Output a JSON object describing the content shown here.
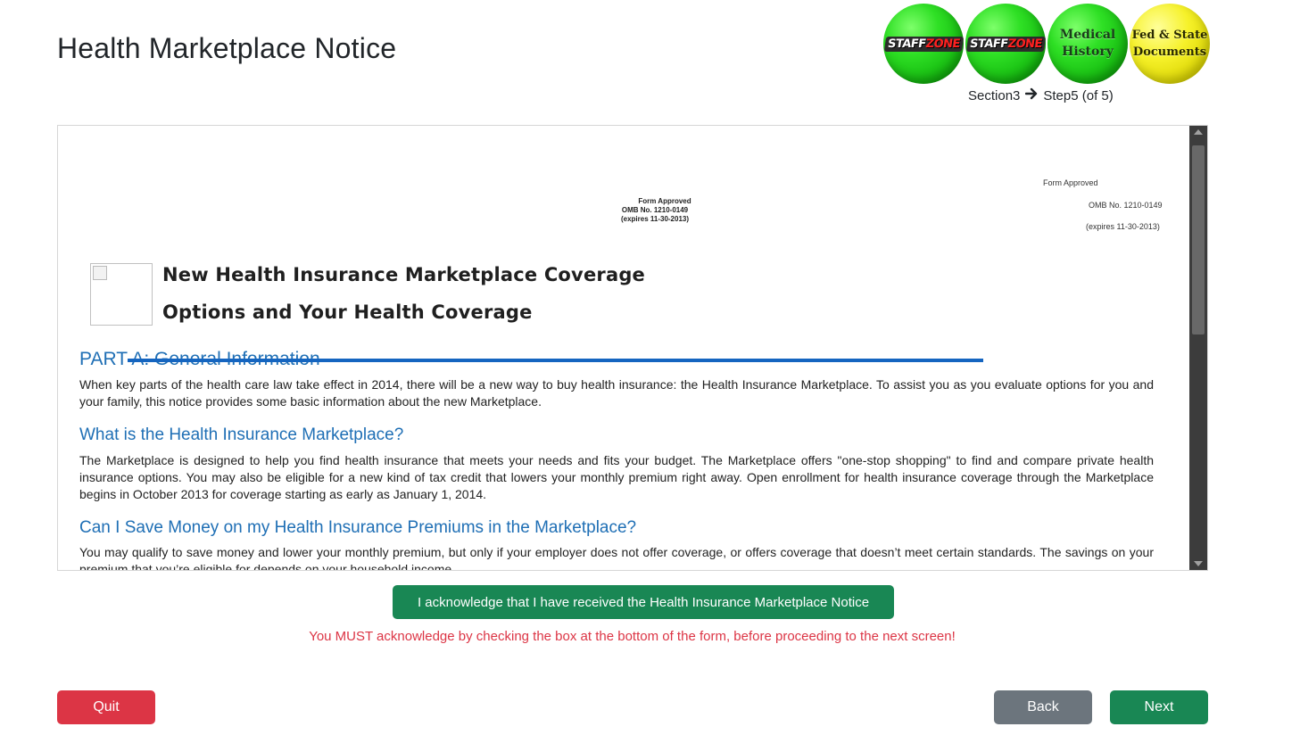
{
  "page": {
    "title": "Health Marketplace Notice"
  },
  "steps": [
    {
      "name": "staffzone-badge-1",
      "logo_main": "STAFF",
      "logo_accent": "ZONE",
      "color": "green"
    },
    {
      "name": "staffzone-badge-2",
      "logo_main": "STAFF",
      "logo_accent": "ZONE",
      "color": "green"
    },
    {
      "name": "medical-history-badge",
      "line1": "Medical",
      "line2": "History",
      "color": "green"
    },
    {
      "name": "fed-state-docs-badge",
      "line1": "Fed & State",
      "line2": "Documents",
      "color": "yellow"
    }
  ],
  "progress": {
    "section": "Section3",
    "step": "Step5 (of 5)",
    "arrow_icon": "arrow-right-icon"
  },
  "document": {
    "form_approved_center": {
      "line1": "Form Approved",
      "line2": "OMB No. 1210-0149",
      "line3": "(expires 11-30-2013)"
    },
    "form_approved_right": {
      "line1": "Form Approved",
      "line2": "OMB No. 1210-0149",
      "line3": "(expires 11-30-2013)"
    },
    "title_line1": "New Health  Insurance Marketplace  Coverage",
    "title_line2": "Options and  Your  Health  Coverage",
    "part_a": "PART A: General  Information",
    "intro": "When key parts of the health care law take effect in 2014, there will be a new way to buy health insurance:  the Health Insurance Marketplace. To assist you as you evaluate options for you and your family, this notice provides some basic information about the new Marketplace.",
    "h1": "What is the Health Insurance Marketplace?",
    "p1": "The Marketplace is designed to help you find health insurance that meets your needs and fits your budget. The Marketplace offers \"one-stop shopping\" to find and compare private health insurance options. You may also be eligible for a new kind of tax credit that lowers your monthly premium right away. Open enrollment for health insurance coverage through the Marketplace begins in October 2013 for coverage starting as early as January 1, 2014.",
    "h2": "Can I Save Money on my Health Insurance Premiums in the Marketplace?",
    "p2": "You may qualify to save money and lower your monthly premium, but only if your employer does not offer coverage, or offers coverage that doesn’t meet certain standards. The savings on your premium that you’re eligible for depends on your household income."
  },
  "acknowledge": {
    "button_label": "I acknowledge that I have received the Health Insurance Marketplace Notice",
    "warning": "You MUST acknowledge by checking the box at the bottom of the form, before proceeding to the next screen!"
  },
  "nav": {
    "quit": "Quit",
    "back": "Back",
    "next": "Next"
  },
  "colors": {
    "success": "#198754",
    "danger": "#dc3545",
    "secondary": "#6c757d",
    "link_blue": "#1f6fb5"
  }
}
